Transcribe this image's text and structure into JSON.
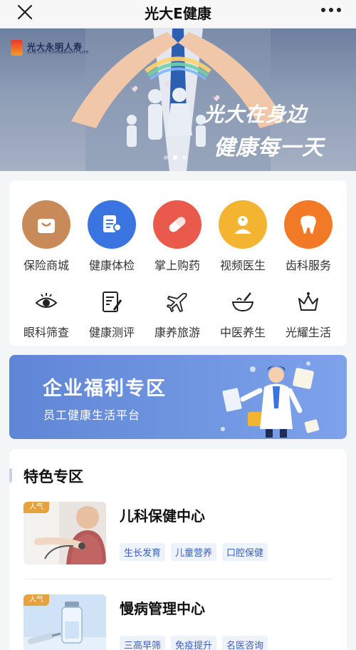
{
  "header": {
    "title": "光大E健康",
    "close_icon": "close-icon",
    "more_icon": "more-dots-icon"
  },
  "banner": {
    "brand_name": "光大永明人寿",
    "brand_sub": "SUN LIFE EVERBRIGHT LIFE",
    "slogan_line1": "光大在身边",
    "slogan_line2": "健康每一天",
    "pages": 3,
    "active_page": 2
  },
  "services": {
    "primary": [
      {
        "label": "保险商城",
        "icon": "shopping-bag-icon",
        "color": "#c98a5a"
      },
      {
        "label": "健康体检",
        "icon": "health-check-icon",
        "color": "#3a74e0"
      },
      {
        "label": "掌上购药",
        "icon": "pill-icon",
        "color": "#ea5a4c"
      },
      {
        "label": "视频医生",
        "icon": "doctor-icon",
        "color": "#f2b431"
      },
      {
        "label": "齿科服务",
        "icon": "tooth-icon",
        "color": "#f27a26"
      }
    ],
    "secondary": [
      {
        "label": "眼科筛查",
        "icon": "eye-icon"
      },
      {
        "label": "健康测评",
        "icon": "assessment-icon"
      },
      {
        "label": "康养旅游",
        "icon": "airplane-icon"
      },
      {
        "label": "中医养生",
        "icon": "herbal-bowl-icon"
      },
      {
        "label": "光耀生活",
        "icon": "crown-icon"
      }
    ]
  },
  "welfare": {
    "title": "企业福利专区",
    "subtitle": "员工健康生活平台"
  },
  "feature": {
    "title": "特色专区",
    "cards": [
      {
        "tag": "人气",
        "title": "儿科保健中心",
        "chips": [
          "生长发育",
          "儿童营养",
          "口腔保健"
        ]
      },
      {
        "tag": "人气",
        "title": "慢病管理中心",
        "chips": [
          "三高早筛",
          "免疫提升",
          "名医咨询"
        ]
      }
    ]
  }
}
